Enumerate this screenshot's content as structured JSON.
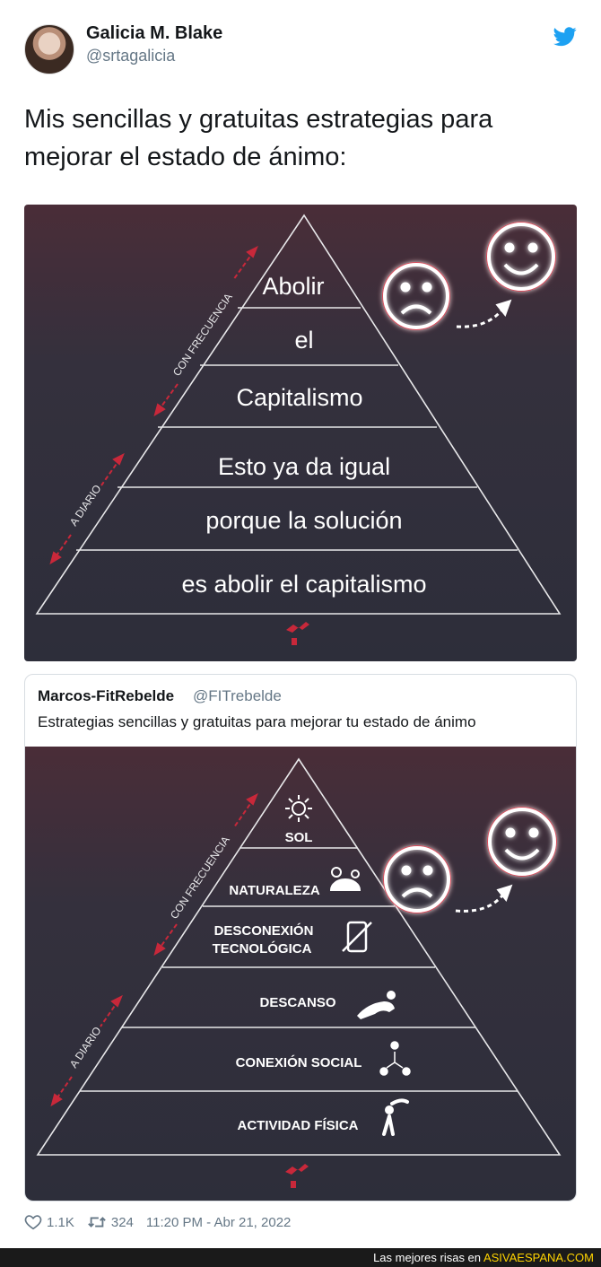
{
  "author": {
    "name": "Galicia M. Blake",
    "handle": "@srtagalicia"
  },
  "tweet_text": "Mis sencillas y gratuitas estrategias para mejorar el estado de ánimo:",
  "main_pyramid": {
    "levels": [
      "Abolir",
      "el",
      "Capitalismo",
      "Esto ya da igual",
      "porque la solución",
      "es abolir el capitalismo"
    ],
    "side_labels": {
      "frequent": "CON FRECUENCIA",
      "daily": "A DIARIO"
    }
  },
  "quoted": {
    "name": "Marcos-FitRebelde",
    "handle": "@FITrebelde",
    "text": "Estrategias sencillas y gratuitas para mejorar tu estado de ánimo",
    "levels": [
      "SOL",
      "NATURALEZA",
      "DESCONEXIÓN",
      "TECNOLÓGICA",
      "DESCANSO",
      "CONEXIÓN SOCIAL",
      "ACTIVIDAD FÍSICA"
    ],
    "side_labels": {
      "frequent": "CON FRECUENCIA",
      "daily": "A DIARIO"
    }
  },
  "footer": {
    "likes": "1.1K",
    "retweets": "324",
    "timestamp": "11:20 PM - Abr 21, 2022"
  },
  "watermark": {
    "prefix": "Las mejores risas en",
    "brand": "ASIVAESPANA.COM"
  },
  "colors": {
    "image_bg": "#2e2f3b",
    "accent_red": "#c8283a",
    "link_blue": "#1da1f2",
    "text_muted": "#657786"
  },
  "icons": [
    "twitter-bird-icon",
    "sad-face-icon",
    "happy-face-icon",
    "sun-icon",
    "nature-icon",
    "no-phone-icon",
    "rest-icon",
    "social-icon",
    "exercise-icon",
    "heart-icon",
    "retweet-icon",
    "logo-icon"
  ]
}
